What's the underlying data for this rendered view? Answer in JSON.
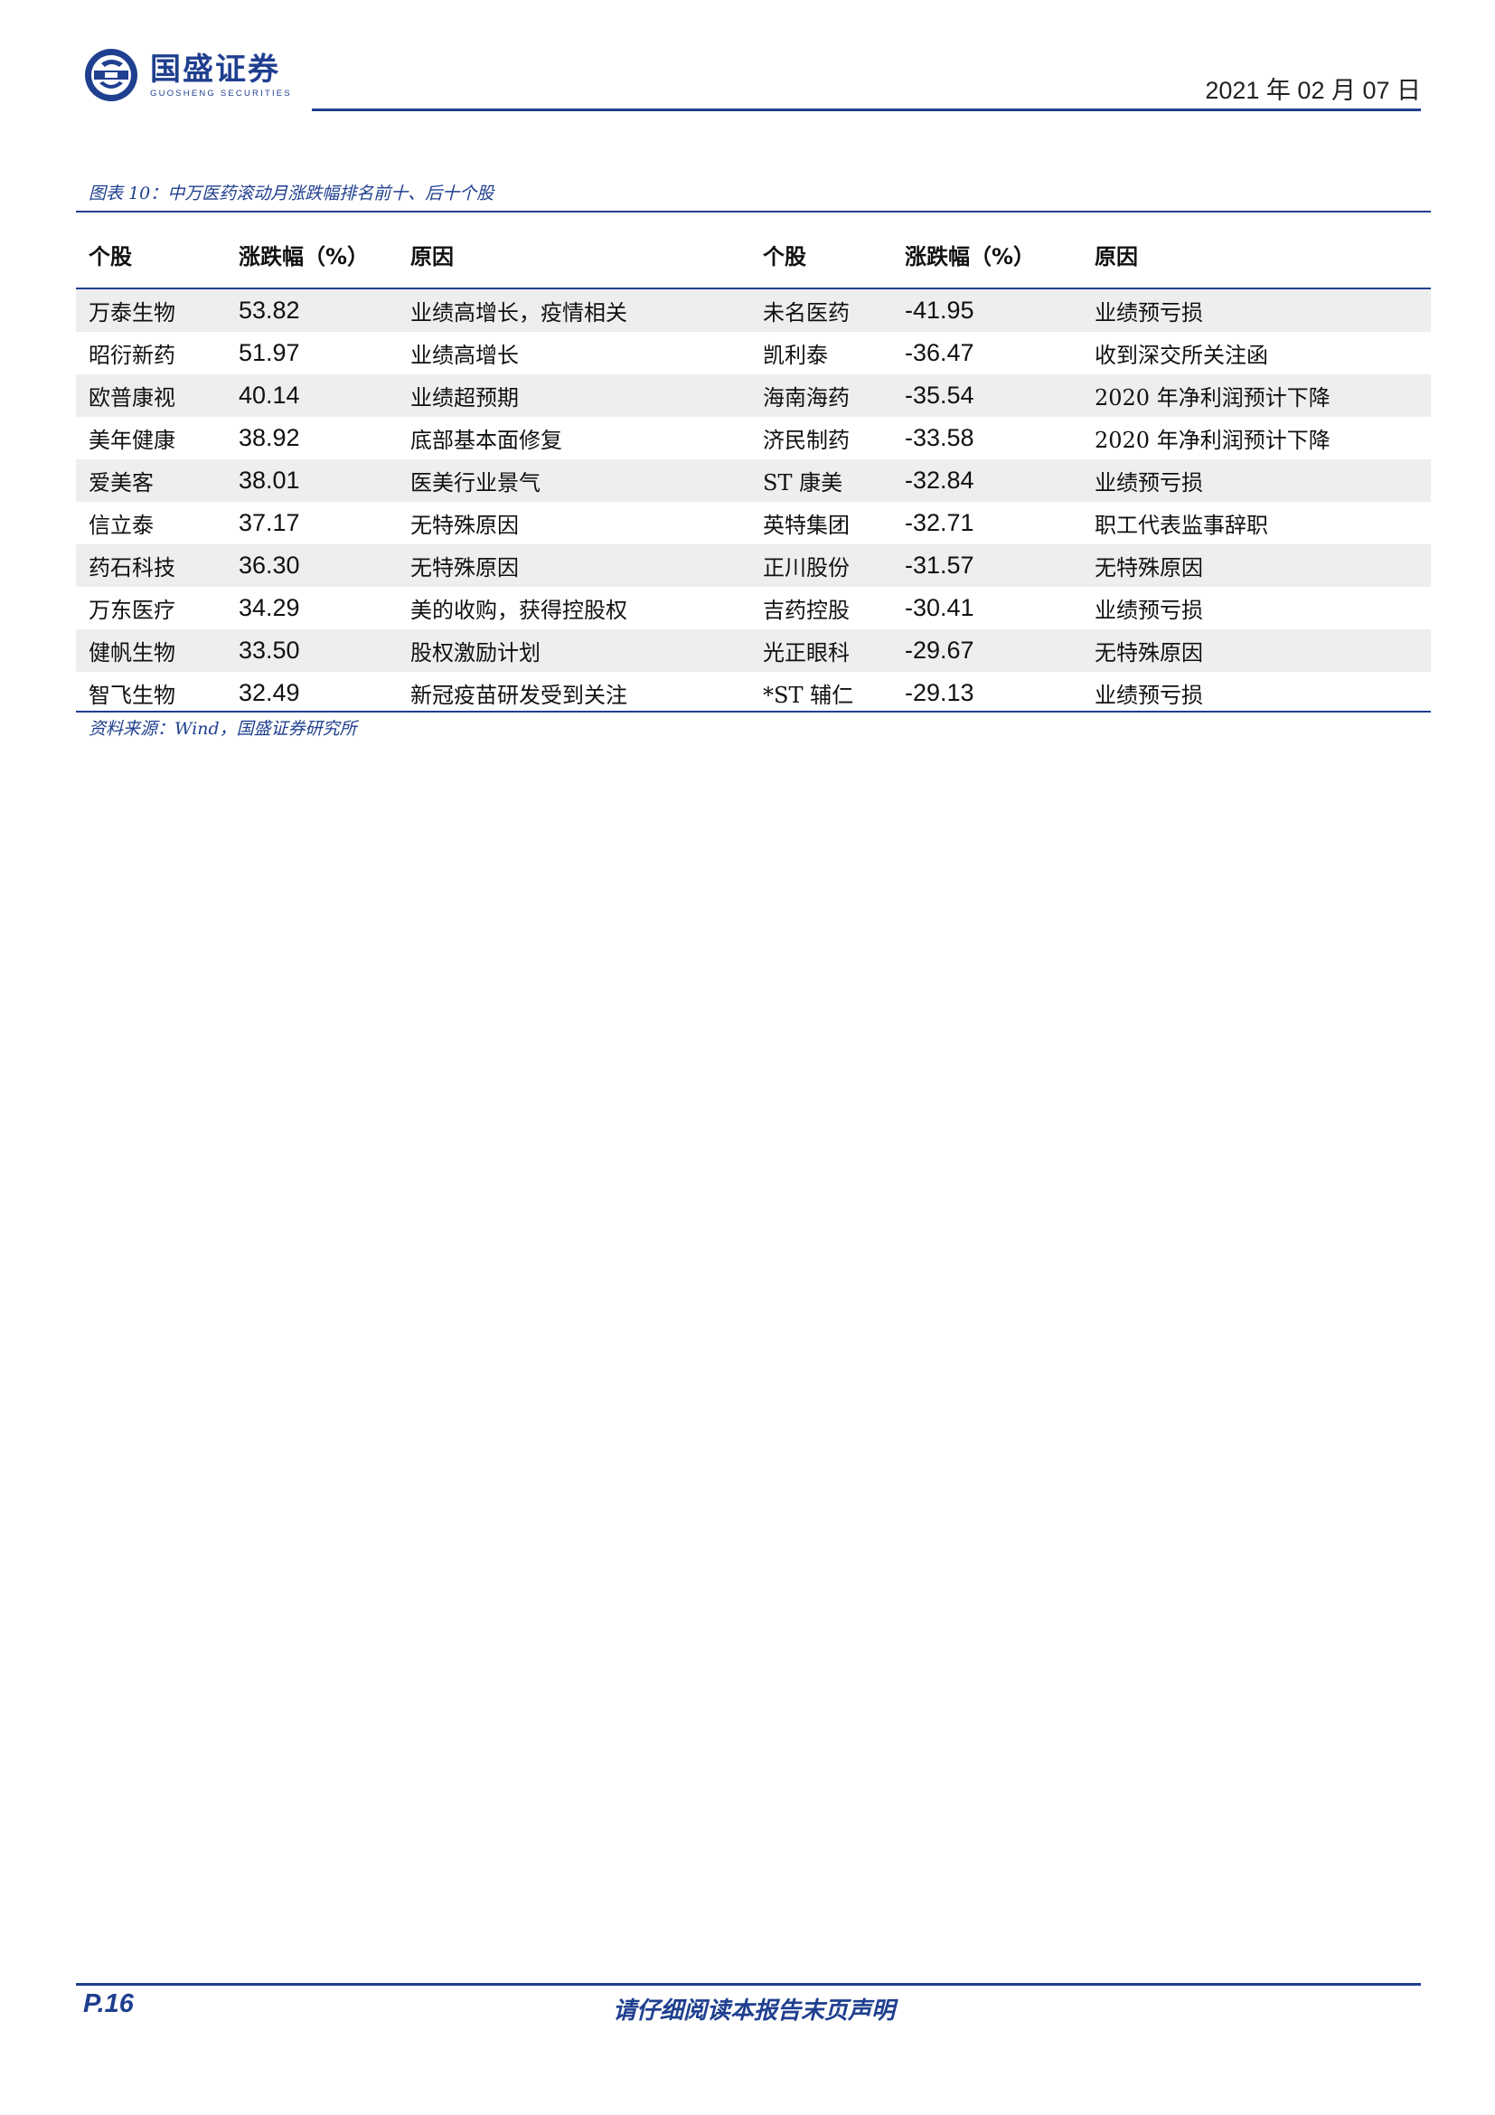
{
  "header": {
    "logo_cn": "国盛证券",
    "logo_en": "GUOSHENG SECURITIES",
    "date": "2021 年 02 月 07 日"
  },
  "figure": {
    "title": "图表 10：中万医药滚动月涨跌幅排名前十、后十个股",
    "source": "资料来源：Wind，国盛证券研究所"
  },
  "table": {
    "headers": [
      "个股",
      "涨跌幅（%）",
      "原因",
      "个股",
      "涨跌幅（%）",
      "原因"
    ],
    "rows": [
      [
        "万泰生物",
        "53.82",
        "业绩高增长，疫情相关",
        "未名医药",
        "-41.95",
        "业绩预亏损"
      ],
      [
        "昭衍新药",
        "51.97",
        "业绩高增长",
        "凯利泰",
        "-36.47",
        "收到深交所关注函"
      ],
      [
        "欧普康视",
        "40.14",
        "业绩超预期",
        "海南海药",
        "-35.54",
        "2020 年净利润预计下降"
      ],
      [
        "美年健康",
        "38.92",
        "底部基本面修复",
        "济民制药",
        "-33.58",
        "2020 年净利润预计下降"
      ],
      [
        "爱美客",
        "38.01",
        "医美行业景气",
        "ST 康美",
        "-32.84",
        "业绩预亏损"
      ],
      [
        "信立泰",
        "37.17",
        "无特殊原因",
        "英特集团",
        "-32.71",
        "职工代表监事辞职"
      ],
      [
        "药石科技",
        "36.30",
        "无特殊原因",
        "正川股份",
        "-31.57",
        "无特殊原因"
      ],
      [
        "万东医疗",
        "34.29",
        "美的收购，获得控股权",
        "吉药控股",
        "-30.41",
        "业绩预亏损"
      ],
      [
        "健帆生物",
        "33.50",
        "股权激励计划",
        "光正眼科",
        "-29.67",
        "无特殊原因"
      ],
      [
        "智飞生物",
        "32.49",
        "新冠疫苗研发受到关注",
        "*ST 辅仁",
        "-29.13",
        "业绩预亏损"
      ]
    ]
  },
  "footer": {
    "page": "P.16",
    "disclaimer": "请仔细阅读本报告末页声明"
  },
  "colors": {
    "brand": "#1f3f8f",
    "row_shade": "#eeeeee"
  }
}
